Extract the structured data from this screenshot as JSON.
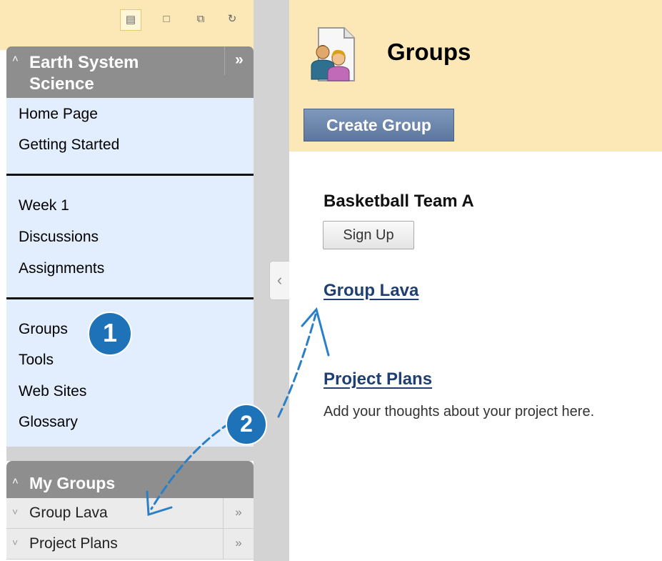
{
  "course_menu": {
    "toolbar_icons": [
      "list-view-icon",
      "folder-view-icon",
      "new-window-icon",
      "refresh-icon"
    ],
    "course_title": "Earth System Science",
    "sections": [
      {
        "items": [
          "Home Page",
          "Getting Started"
        ]
      },
      {
        "items": [
          "Week 1",
          "Discussions",
          "Assignments"
        ]
      },
      {
        "items": [
          "Groups",
          "Tools",
          "Web Sites",
          "Glossary"
        ]
      }
    ]
  },
  "my_groups": {
    "title": "My Groups",
    "items": [
      "Group Lava",
      "Project Plans"
    ]
  },
  "main": {
    "page_title": "Groups",
    "create_button": "Create Group",
    "groups": [
      {
        "name": "Basketball Team A",
        "action": "Sign Up"
      },
      {
        "name": "Group Lava"
      },
      {
        "name": "Project Plans",
        "description": "Add your thoughts about your project here."
      }
    ]
  },
  "annotations": {
    "callout_1": "1",
    "callout_2": "2"
  },
  "colors": {
    "header_bg": "#fbe8b6",
    "menu_bg": "#e2eefd",
    "menu_header": "#8e8e8e",
    "button_blue": "#6a84ab",
    "link": "#1f3f73",
    "callout": "#1e73b8"
  }
}
